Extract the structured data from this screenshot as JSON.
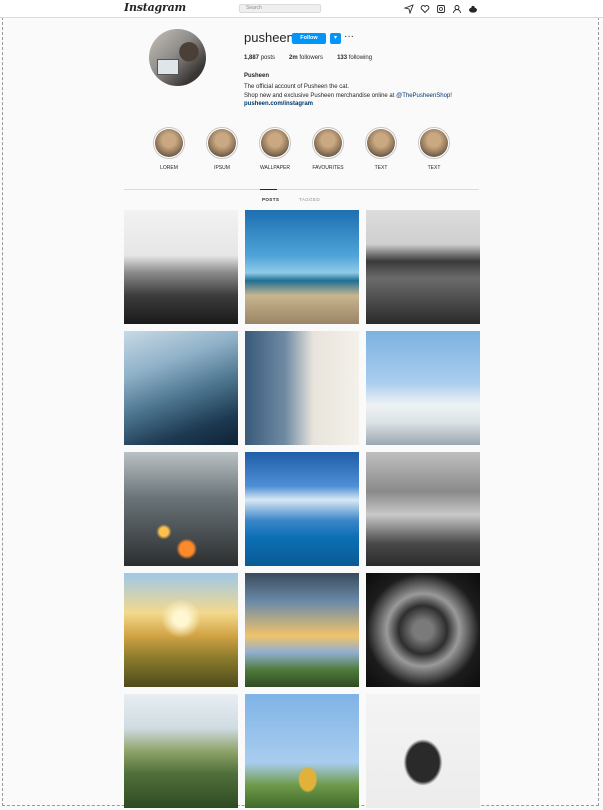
{
  "nav": {
    "logo": "Instagram",
    "search_placeholder": "Search",
    "icons": [
      "explore-icon",
      "heart-icon",
      "messages-icon",
      "profile-icon",
      "cart-icon"
    ]
  },
  "profile": {
    "username": "pusheen",
    "follow_label": "Follow",
    "stats": {
      "posts": "1,887",
      "posts_label": "posts",
      "followers": "2m",
      "followers_label": "followers",
      "following": "133",
      "following_label": "following"
    },
    "full_name": "Pusheen",
    "bio_line1": "The official account of Pusheen the cat.",
    "bio_line2_prefix": "Shop new and exclusive Pusheen merchandise online at ",
    "bio_line2_tag": "@ThePusheenShop!",
    "link": "pusheen.com/instagram"
  },
  "highlights": [
    "LOREM",
    "IPSUM",
    "WALLPAPER",
    "FAVOURITES",
    "TEXT",
    "TEXT"
  ],
  "tabs": {
    "posts": "POSTS",
    "tagged": "TAGGED"
  },
  "posts": [
    "bw-hillside-path",
    "beach-sunset",
    "coastal-cliff-village",
    "misty-blue-mountains",
    "double-exposure-building",
    "santorini-windmill",
    "rainy-window-bokeh",
    "ocean-boat-clouds",
    "foggy-forest",
    "golden-field-sunset",
    "tree-framed-lake",
    "looking-up-buildings",
    "river-valley-aerial",
    "pineapple-on-grass",
    "typewriter"
  ]
}
